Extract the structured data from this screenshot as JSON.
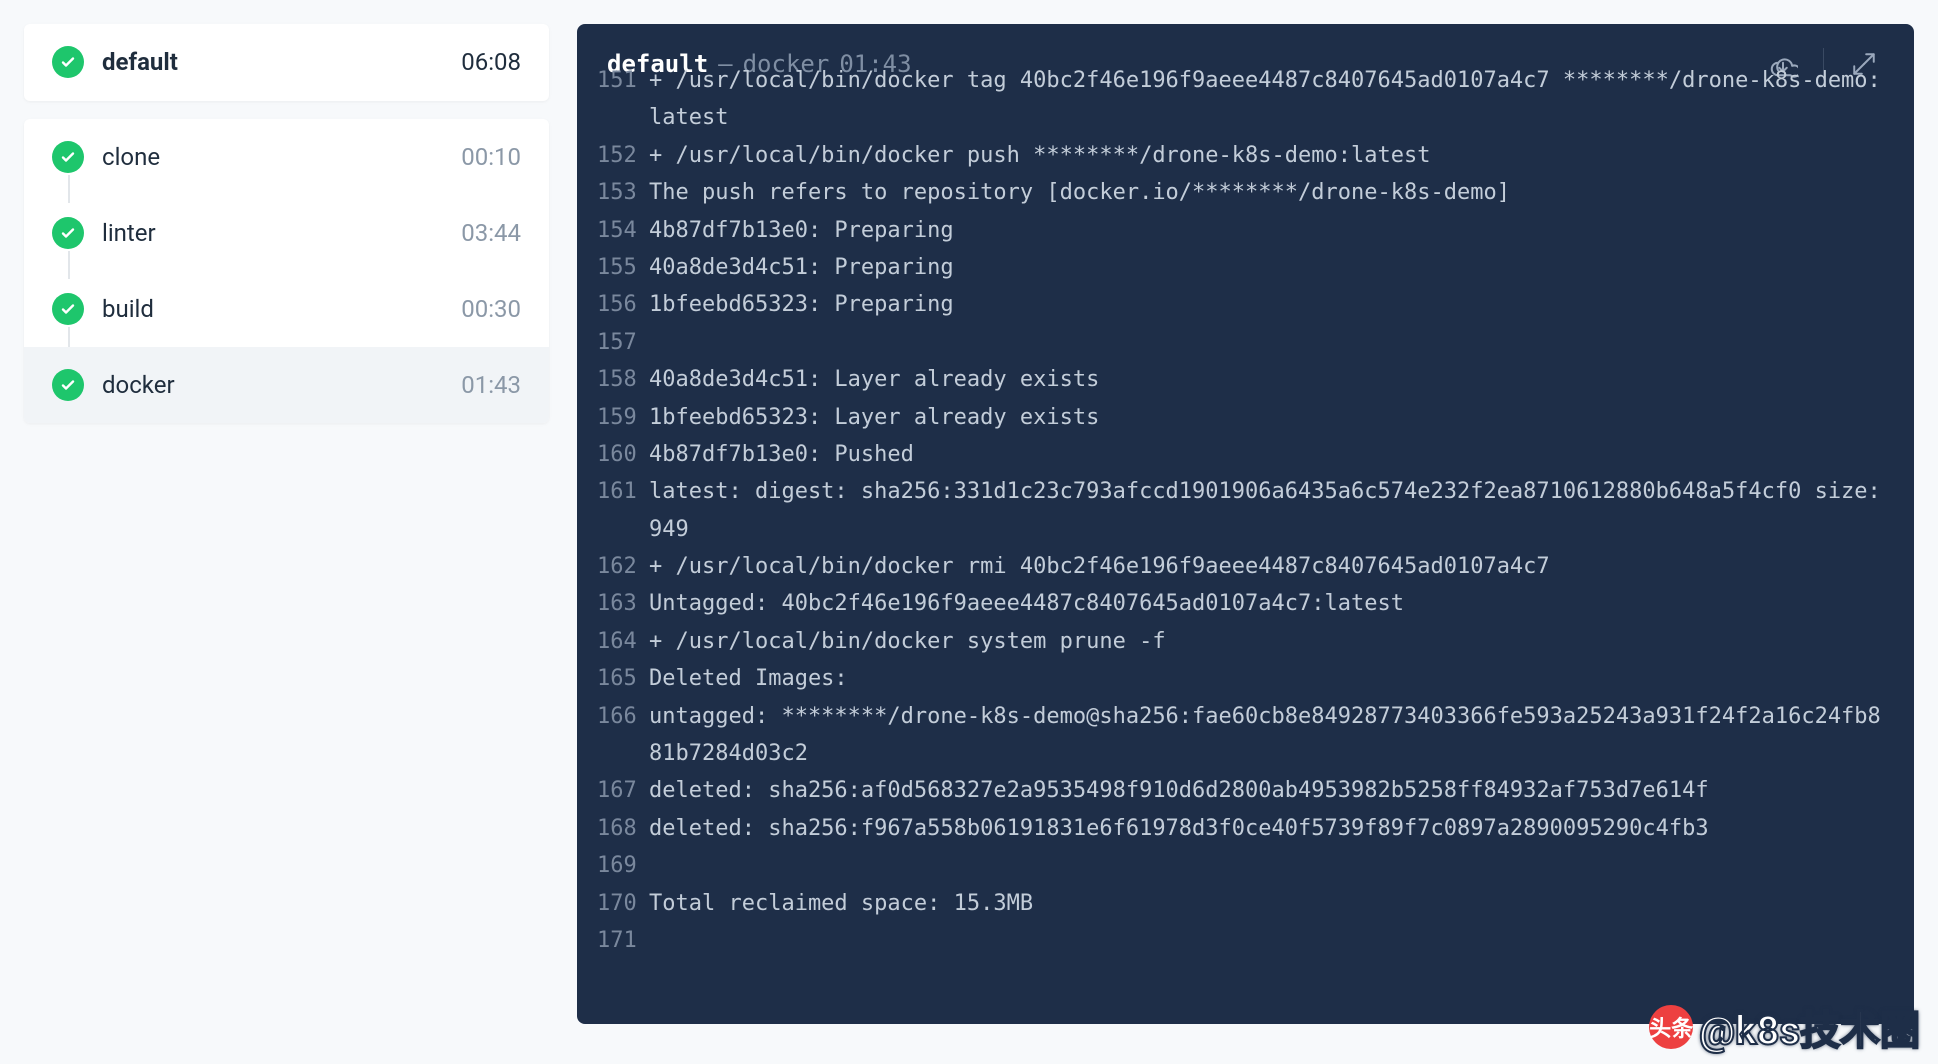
{
  "sidebar": {
    "stage": {
      "label": "default",
      "duration": "06:08"
    },
    "steps": [
      {
        "label": "clone",
        "duration": "00:10",
        "selected": false
      },
      {
        "label": "linter",
        "duration": "03:44",
        "selected": false
      },
      {
        "label": "build",
        "duration": "00:30",
        "selected": false
      },
      {
        "label": "docker",
        "duration": "01:43",
        "selected": true
      }
    ]
  },
  "log": {
    "pipeline": "default",
    "separator": "—",
    "step": "docker",
    "duration": "01:43",
    "lines": [
      {
        "n": "151",
        "t": "+ /usr/local/bin/docker tag 40bc2f46e196f9aeee4487c8407645ad0107a4c7 ********/drone-k8s-demo:latest"
      },
      {
        "n": "152",
        "t": "+ /usr/local/bin/docker push ********/drone-k8s-demo:latest"
      },
      {
        "n": "153",
        "t": "The push refers to repository [docker.io/********/drone-k8s-demo]"
      },
      {
        "n": "154",
        "t": "4b87df7b13e0: Preparing"
      },
      {
        "n": "155",
        "t": "40a8de3d4c51: Preparing"
      },
      {
        "n": "156",
        "t": "1bfeebd65323: Preparing"
      },
      {
        "n": "157",
        "t": ""
      },
      {
        "n": "158",
        "t": "40a8de3d4c51: Layer already exists"
      },
      {
        "n": "159",
        "t": "1bfeebd65323: Layer already exists"
      },
      {
        "n": "160",
        "t": "4b87df7b13e0: Pushed"
      },
      {
        "n": "161",
        "t": "latest: digest: sha256:331d1c23c793afccd1901906a6435a6c574e232f2ea8710612880b648a5f4cf0 size: 949"
      },
      {
        "n": "162",
        "t": "+ /usr/local/bin/docker rmi 40bc2f46e196f9aeee4487c8407645ad0107a4c7"
      },
      {
        "n": "163",
        "t": "Untagged: 40bc2f46e196f9aeee4487c8407645ad0107a4c7:latest"
      },
      {
        "n": "164",
        "t": "+ /usr/local/bin/docker system prune -f"
      },
      {
        "n": "165",
        "t": "Deleted Images:"
      },
      {
        "n": "166",
        "t": "untagged: ********/drone-k8s-demo@sha256:fae60cb8e84928773403366fe593a25243a931f24f2a16c24fb881b7284d03c2"
      },
      {
        "n": "167",
        "t": "deleted: sha256:af0d568327e2a9535498f910d6d2800ab4953982b5258ff84932af753d7e614f"
      },
      {
        "n": "168",
        "t": "deleted: sha256:f967a558b06191831e6f61978d3f0ce40f5739f89f7c0897a2890095290c4fb3"
      },
      {
        "n": "169",
        "t": ""
      },
      {
        "n": "170",
        "t": "Total reclaimed space: 15.3MB"
      },
      {
        "n": "171",
        "t": ""
      }
    ]
  },
  "watermark": {
    "badge": "头条",
    "text": "@k8s技术圈"
  }
}
